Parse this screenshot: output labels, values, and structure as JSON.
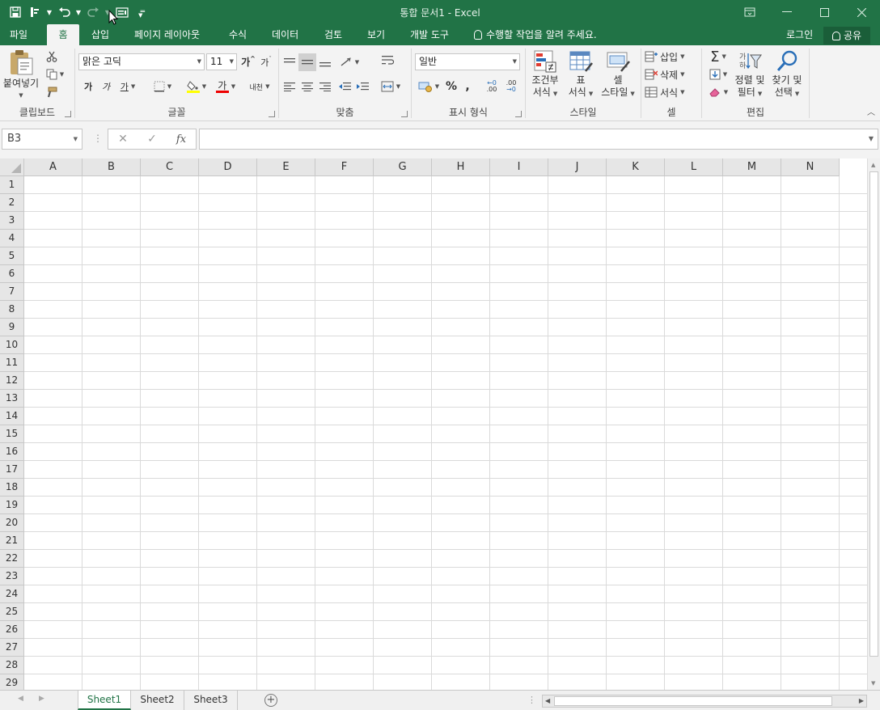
{
  "window": {
    "title": "통합 문서1 - Excel",
    "accent_color": "#217346"
  },
  "qat": {
    "icons": [
      "save-icon",
      "touch-mode-icon",
      "undo-icon",
      "redo-icon",
      "form-icon",
      "customize-icon"
    ]
  },
  "tabs": [
    {
      "label": "파일"
    },
    {
      "label": "홈",
      "active": true
    },
    {
      "label": "삽입"
    },
    {
      "label": "페이지 레이아웃"
    },
    {
      "label": "수식"
    },
    {
      "label": "데이터"
    },
    {
      "label": "검토"
    },
    {
      "label": "보기"
    },
    {
      "label": "개발 도구"
    }
  ],
  "tell_me": "수행할 작업을 알려 주세요.",
  "login": "로그인",
  "share": "공유",
  "ribbon": {
    "clipboard": {
      "paste": "붙여넣기",
      "label": "클립보드"
    },
    "font": {
      "name": "맑은 고딕",
      "size": "11",
      "grow": "가",
      "shrink": "가",
      "bold": "가",
      "italic": "가",
      "underline": "가",
      "font_color_glyph": "가",
      "phonetic": "내천",
      "label": "글꼴"
    },
    "alignment": {
      "label": "맞춤"
    },
    "number": {
      "format": "일반",
      "percent": "%",
      "comma": ",",
      "inc_decimal": ".00",
      "dec_decimal": ".00",
      "label": "표시 형식"
    },
    "styles": {
      "conditional_line1": "조건부",
      "conditional_line2": "서식",
      "table_line1": "표",
      "table_line2": "서식",
      "cell_line1": "셀",
      "cell_line2": "스타일",
      "label": "스타일"
    },
    "cells": {
      "insert": "삽입",
      "delete": "삭제",
      "format": "서식",
      "label": "셀"
    },
    "editing": {
      "sort_line1": "정렬 및",
      "sort_line2": "필터",
      "find_line1": "찾기 및",
      "find_line2": "선택",
      "label": "편집"
    }
  },
  "formula_bar": {
    "name_box": "B3",
    "formula": "",
    "fx": "fx"
  },
  "columns": [
    "A",
    "B",
    "C",
    "D",
    "E",
    "F",
    "G",
    "H",
    "I",
    "J",
    "K",
    "L",
    "M",
    "N"
  ],
  "rows": [
    "1",
    "2",
    "3",
    "4",
    "5",
    "6",
    "7",
    "8",
    "9",
    "10",
    "11",
    "12",
    "13",
    "14",
    "15",
    "16",
    "17",
    "18",
    "19",
    "20",
    "21",
    "22",
    "23",
    "24",
    "25",
    "26",
    "27",
    "28",
    "29"
  ],
  "sheets": [
    {
      "label": "Sheet1",
      "active": true
    },
    {
      "label": "Sheet2"
    },
    {
      "label": "Sheet3"
    }
  ]
}
